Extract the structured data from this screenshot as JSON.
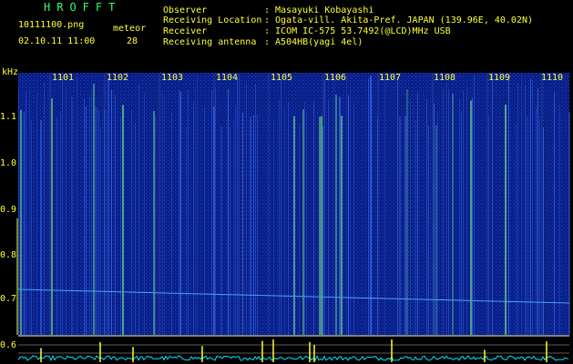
{
  "header": {
    "app_title": "HROFFT",
    "filename": "10111100.png",
    "datetime": "02.10.11 11:00",
    "meteor_label": "meteor",
    "meteor_count": "28",
    "fields": [
      {
        "label": "Observer",
        "value": ": Masayuki Kobayashi"
      },
      {
        "label": "Receiving Location",
        "value": ": Ogata-vill. Akita-Pref. JAPAN (139.96E, 40.02N)"
      },
      {
        "label": "Receiver",
        "value": ": ICOM IC-575 53.7492(@LCD)MHz USB"
      },
      {
        "label": "Receiving antenna",
        "value": ": A504HB(yagi 4el)"
      }
    ]
  },
  "axis": {
    "unit": "kHz",
    "ticks": [
      "1.1",
      "1.0",
      "0.9",
      "0.8",
      "0.7",
      "0.6"
    ]
  },
  "minutes": [
    "1101",
    "1102",
    "1103",
    "1104",
    "1105",
    "1106",
    "1107",
    "1108",
    "1109",
    "1110"
  ],
  "colors": {
    "label_yellow": "#ffff33",
    "label_green": "#33ff66",
    "background_blue": "#0a1f8a",
    "grid_white": "#ffffff",
    "trace_cyan": "#00e5ff"
  }
}
